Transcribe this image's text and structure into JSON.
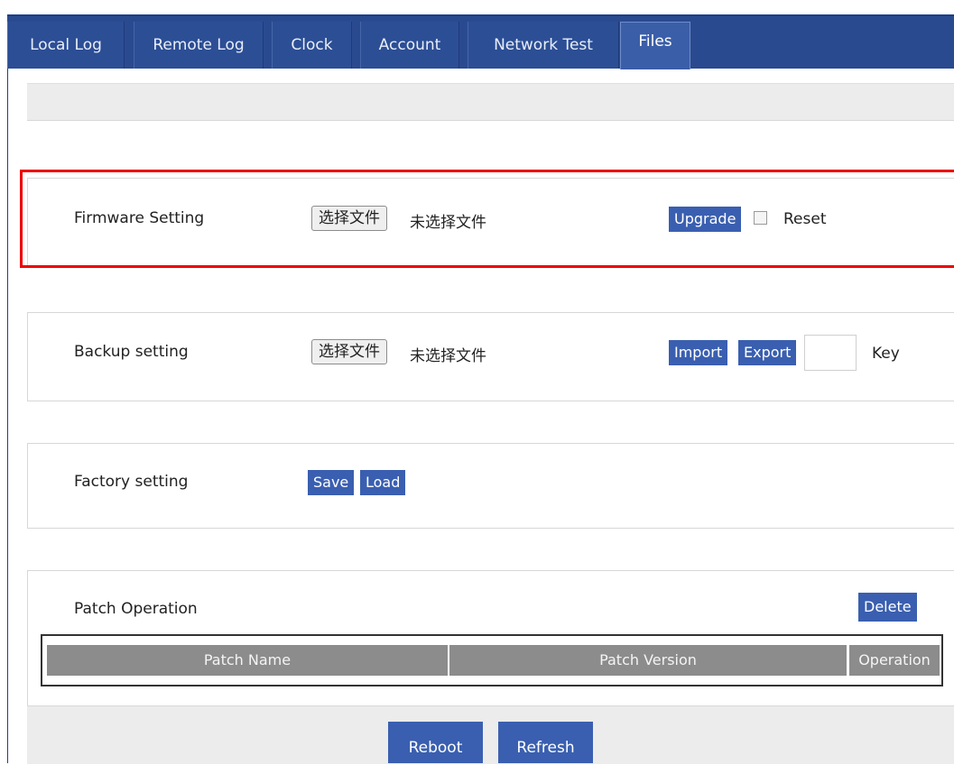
{
  "tabs": [
    {
      "label": "Local Log"
    },
    {
      "label": "Remote Log"
    },
    {
      "label": "Clock"
    },
    {
      "label": "Account"
    },
    {
      "label": "Network Test"
    },
    {
      "label": "Files",
      "active": true
    }
  ],
  "firmware": {
    "label": "Firmware Setting",
    "choose_file": "选择文件",
    "file_status": "未选择文件",
    "upgrade": "Upgrade",
    "reset_label": "Reset",
    "reset_checked": false
  },
  "backup": {
    "label": "Backup setting",
    "choose_file": "选择文件",
    "file_status": "未选择文件",
    "import": "Import",
    "export": "Export",
    "key_value": "",
    "key_label": "Key"
  },
  "factory": {
    "label": "Factory setting",
    "save": "Save",
    "load": "Load"
  },
  "patch": {
    "label": "Patch Operation",
    "delete": "Delete",
    "columns": [
      "Patch Name",
      "Patch Version",
      "Operation"
    ]
  },
  "footer": {
    "reboot": "Reboot",
    "refresh": "Refresh"
  },
  "colors": {
    "tab_bar": "#2a4a90",
    "button": "#3a5fb0",
    "highlight": "#e00000",
    "table_header": "#8c8c8c"
  }
}
